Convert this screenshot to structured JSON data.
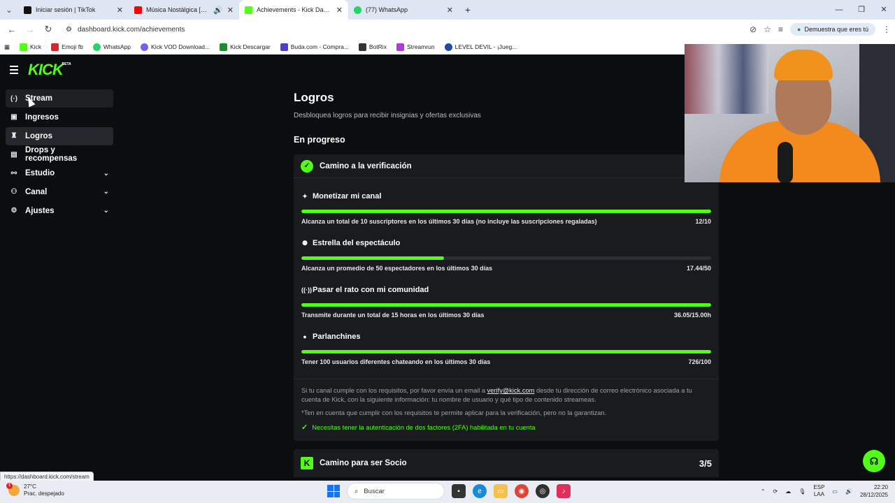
{
  "browser": {
    "tabs": [
      {
        "title": "Iniciar sesión | TikTok",
        "favicon_color": "#111111",
        "active": false
      },
      {
        "title": "Música Nostálgica [Mú",
        "favicon_color": "#ff0000",
        "active": false
      },
      {
        "title": "Achievements - Kick Dashboard",
        "favicon_color": "#53fc18",
        "active": true
      },
      {
        "title": "(77) WhatsApp",
        "favicon_color": "#25d366",
        "active": false
      }
    ],
    "url": "dashboard.kick.com/achievements",
    "verify_pill": "Demuestra que eres tú",
    "bookmarks": [
      {
        "label": "Kick",
        "color": "#53fc18"
      },
      {
        "label": "Emoji fb",
        "color": "#d9232e"
      },
      {
        "label": "WhatsApp",
        "color": "#25d366"
      },
      {
        "label": "Kick VOD Download...",
        "color": "#7a5cff"
      },
      {
        "label": "Kick Descargar",
        "color": "#1d8c2e"
      },
      {
        "label": "Buda.com - Compra...",
        "color": "#4b3fc7"
      },
      {
        "label": "BotRix",
        "color": "#333333"
      },
      {
        "label": "Streamrun",
        "color": "#b03ad9"
      },
      {
        "label": "LEVEL DEVIL - ¡Jueg...",
        "color": "#1f4aa8"
      }
    ]
  },
  "sidebar": {
    "items": [
      {
        "label": "Stream",
        "icon": "broadcast-icon",
        "glyph": "(·)"
      },
      {
        "label": "Ingresos",
        "icon": "money-icon",
        "glyph": "▣"
      },
      {
        "label": "Logros",
        "icon": "trophy-icon",
        "glyph": "♜"
      },
      {
        "label": "Drops y recompensas",
        "icon": "gift-icon",
        "glyph": "▤"
      },
      {
        "label": "Estudio",
        "icon": "studio-icon",
        "glyph": "⚯"
      },
      {
        "label": "Canal",
        "icon": "channel-icon",
        "glyph": "⚇"
      },
      {
        "label": "Ajustes",
        "icon": "gear-icon",
        "glyph": "⚙"
      }
    ]
  },
  "main": {
    "title": "Logros",
    "subtitle": "Desbloquea logros para recibir insignias y ofertas exclusivas",
    "section": "En progreso",
    "card": {
      "title": "Camino a la verificación",
      "achievements": [
        {
          "title": "Monetizar mi canal",
          "icon": "sparkle-icon",
          "glyph": "✦",
          "description": "Alcanza un total de 10 suscriptores en los últimos 30 días (no incluye las suscripciones regaladas)",
          "progress_text": "12/10",
          "progress": 1.0
        },
        {
          "title": "Estrella del espectáculo",
          "icon": "people-icon",
          "glyph": "⚉",
          "description": "Alcanza un promedio de 50 espectadores en los últimos 30 días",
          "progress_text": "17.44/50",
          "progress": 0.3488
        },
        {
          "title": "Pasar el rato con mi comunidad",
          "icon": "broadcast-icon",
          "glyph": "((·))",
          "description": "Transmite durante un total de 15 horas en los últimos 30 días",
          "progress_text": "36.05/15.00h",
          "progress": 1.0
        },
        {
          "title": "Parlanchines",
          "icon": "chat-icon",
          "glyph": "●",
          "description": "Tener 100 usuarios diferentes chateando en los últimos 30 días",
          "progress_text": "726/100",
          "progress": 1.0
        }
      ],
      "footer_before_link": "Si tu canal cumple con los requisitos, por favor envía un email a ",
      "footer_link": "verify@kick.com",
      "footer_after_link": " desde tu dirección de correo electrónico asociada a tu cuenta de Kick, con la siguiente información: tu nombre de usuario y qué tipo de contenido streameas.",
      "note": "*Ten en cuenta que cumplir con los requisitos te permite aplicar para la verificación, pero no la garantizan.",
      "requirement": "Necesitas tener la autenticación de dos factores (2FA) habilitada en tu cuenta"
    },
    "card2": {
      "title": "Camino para ser Socio",
      "count": "3/5"
    }
  },
  "status_url": "https://dashboard.kick.com/stream",
  "taskbar": {
    "temperature": "27°C",
    "weather": "Prac. despejado",
    "weather_badge": "1",
    "search_placeholder": "Buscar",
    "lang_line1": "ESP",
    "lang_line2": "LAA",
    "time": "22:20",
    "date": "28/12/2025"
  },
  "colors": {
    "accent": "#53fc18",
    "background": "#0b0e0f",
    "card": "#191b1f"
  }
}
